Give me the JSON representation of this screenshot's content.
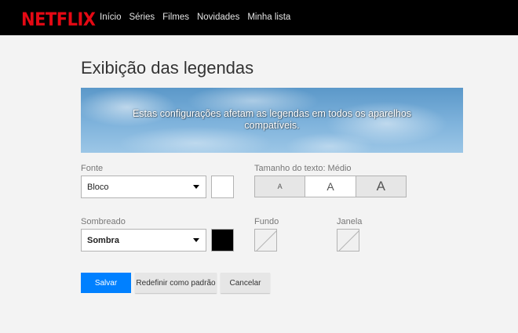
{
  "brand": {
    "logo": "NETFLIX",
    "logo_color": "#e50914"
  },
  "nav": {
    "items": [
      "Início",
      "Séries",
      "Filmes",
      "Novidades",
      "Minha lista"
    ]
  },
  "page": {
    "title": "Exibição das legendas"
  },
  "preview": {
    "text": "Estas configurações afetam as legendas em todos os aparelhos compatíveis."
  },
  "font": {
    "label": "Fonte",
    "selected": "Bloco",
    "color": "#ffffff"
  },
  "text_size": {
    "label": "Tamanho do texto: Médio",
    "options": [
      "A",
      "A",
      "A"
    ],
    "selected_index": 1
  },
  "shadow": {
    "label": "Sombreado",
    "selected": "Sombra",
    "color": "#000000"
  },
  "background": {
    "label": "Fundo"
  },
  "window": {
    "label": "Janela"
  },
  "actions": {
    "save": "Salvar",
    "reset": "Redefinir como padrão",
    "cancel": "Cancelar",
    "save_color": "#0080ff"
  }
}
